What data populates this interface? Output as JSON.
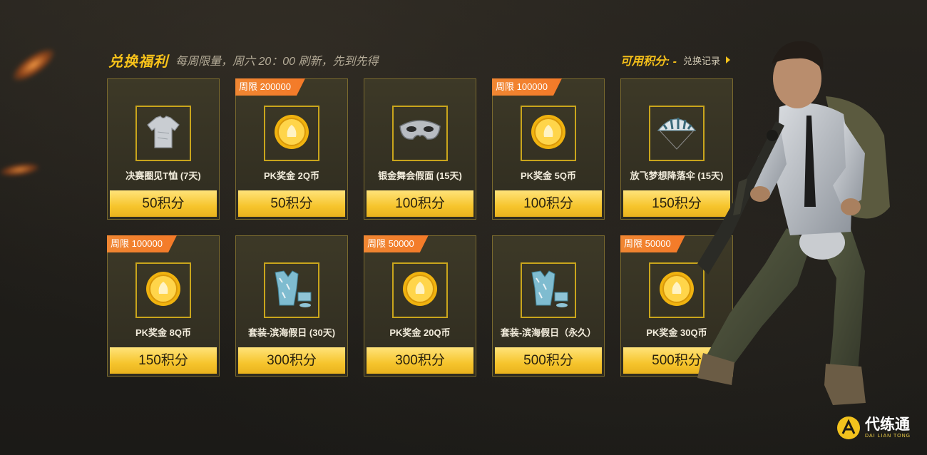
{
  "header": {
    "title": "兑换福利",
    "subtitle": "每周限量，周六 20：00 刷新，先到先得",
    "points_label": "可用积分: -",
    "history_link": "兑换记录"
  },
  "items": [
    {
      "name": "决赛圈见T恤 (7天)",
      "price": "50积分",
      "limit": "",
      "icon": "tshirt-icon"
    },
    {
      "name": "PK奖金 2Q币",
      "price": "50积分",
      "limit": "周限 200000",
      "icon": "coin-icon"
    },
    {
      "name": "银金舞会假面 (15天)",
      "price": "100积分",
      "limit": "",
      "icon": "mask-icon"
    },
    {
      "name": "PK奖金 5Q币",
      "price": "100积分",
      "limit": "周限 100000",
      "icon": "coin-icon"
    },
    {
      "name": "放飞梦想降落伞 (15天)",
      "price": "150积分",
      "limit": "",
      "icon": "parachute-icon"
    },
    {
      "name": "PK奖金 8Q币",
      "price": "150积分",
      "limit": "周限 100000",
      "icon": "coin-icon"
    },
    {
      "name": "套装-滨海假日 (30天)",
      "price": "300积分",
      "limit": "",
      "icon": "outfit-icon"
    },
    {
      "name": "PK奖金 20Q币",
      "price": "300积分",
      "limit": "周限 50000",
      "icon": "coin-icon"
    },
    {
      "name": "套装-滨海假日（永久）",
      "price": "500积分",
      "limit": "",
      "icon": "outfit-icon"
    },
    {
      "name": "PK奖金 30Q币",
      "price": "500积分",
      "limit": "周限 50000",
      "icon": "coin-icon"
    }
  ],
  "logo": {
    "name": "代练通",
    "sub": "DAI LIAN TONG"
  },
  "colors": {
    "accent": "#f7c21a",
    "badge": "#f47a28",
    "card_border": "#7a6a2e",
    "background": "#24221d"
  }
}
